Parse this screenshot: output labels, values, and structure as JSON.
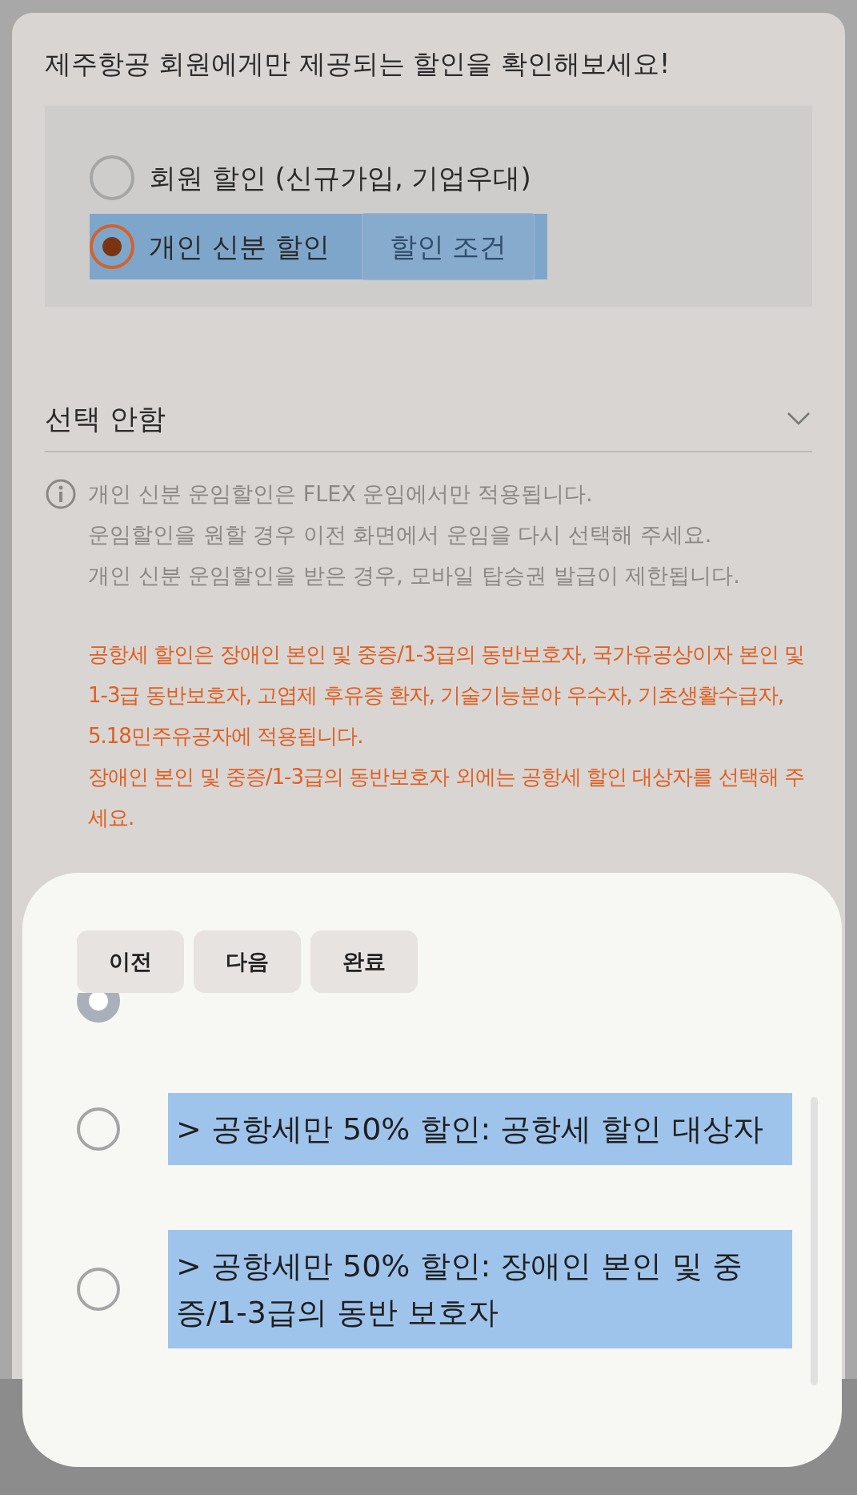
{
  "subtitle": "제주항공 회원에게만 제공되는 할인을 확인해보세요!",
  "discount_types": [
    {
      "label": "회원 할인 (신규가입, 기업우대)",
      "selected": false,
      "highlighted": false
    },
    {
      "label": "개인 신분 할인",
      "selected": true,
      "highlighted": true,
      "button": "할인 조건"
    }
  ],
  "dropdown": {
    "value": "선택 안함"
  },
  "info_lines": [
    "개인 신분 운임할인은 FLEX 운임에서만 적용됩니다.",
    "운임할인을 원할 경우 이전 화면에서 운임을 다시 선택해 주세요.",
    "개인 신분 운임할인을 받은 경우, 모바일 탑승권 발급이 제한됩니다."
  ],
  "warnings": [
    "공항세 할인은 장애인 본인 및 중증/1-3급의 동반보호자, 국가유공상이자 본인 및 1-3급 동반보호자, 고엽제 후유증 환자, 기술기능분야 우수자, 기초생활수급자, 5.18민주유공자에 적용됩니다.",
    "장애인 본인 및 중증/1-3급의 동반보호자 외에는 공항세 할인 대상자를 선택해 주세요."
  ],
  "picker": {
    "buttons": [
      "이전",
      "다음",
      "완료"
    ],
    "options": [
      {
        "selected": true
      },
      {
        "label": "> 공항세만 50% 할인: 공항세 할인 대상자",
        "selected": false,
        "highlighted": true
      },
      {
        "label": "> 공항세만 50% 할인: 장애인 본인 및 중증/1-3급의 동반 보호자",
        "selected": false,
        "highlighted": true
      }
    ]
  }
}
